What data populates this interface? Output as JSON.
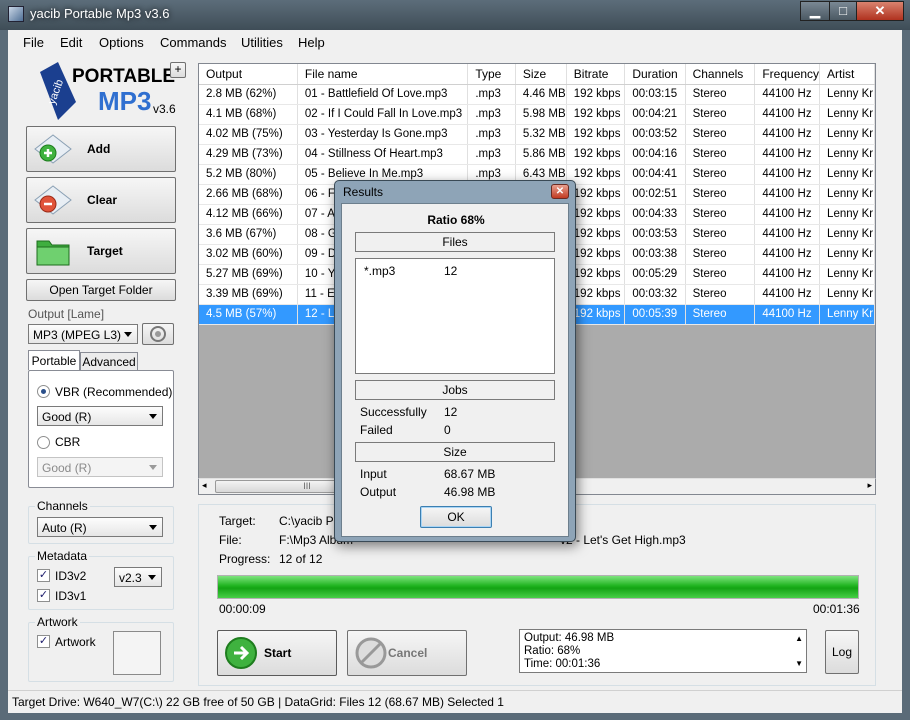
{
  "window": {
    "title": "yacib Portable Mp3 v3.6",
    "min": "▁",
    "max": "□",
    "close": "✕"
  },
  "menu": [
    "File",
    "Edit",
    "Options",
    "Commands",
    "Utilities",
    "Help"
  ],
  "logo": {
    "line1": "PORTABLE",
    "line2": "MP3",
    "version": "v3.6",
    "brand": "yacib"
  },
  "plus_label": "+",
  "buttons": {
    "add": "Add",
    "clear": "Clear",
    "target": "Target",
    "open_target": "Open Target Folder",
    "start": "Start",
    "cancel": "Cancel",
    "log": "Log",
    "ok": "OK"
  },
  "output": {
    "label": "Output [Lame]",
    "value": "MP3 (MPEG L3)"
  },
  "tabs": [
    "Portable",
    "Advanced"
  ],
  "vbr": {
    "label": "VBR (Recommended)",
    "value": "Good (R)",
    "checked": true
  },
  "cbr": {
    "label": "CBR",
    "value": "Good (R)",
    "checked": false
  },
  "channels": {
    "label": "Channels",
    "value": "Auto (R)"
  },
  "metadata": {
    "label": "Metadata",
    "id3v2": "ID3v2",
    "id3v1": "ID3v1",
    "version": "v2.3"
  },
  "artwork": {
    "label": "Artwork",
    "check": "Artwork"
  },
  "grid": {
    "columns": [
      "Output",
      "File name",
      "Type",
      "Size",
      "Bitrate",
      "Duration",
      "Channels",
      "Frequency",
      "Artist"
    ],
    "rows": [
      [
        "2.8 MB (62%)",
        "01 - Battlefield Of Love.mp3",
        ".mp3",
        "4.46 MB",
        "192 kbps",
        "00:03:15",
        "Stereo",
        "44100 Hz",
        "Lenny Kr"
      ],
      [
        "4.1 MB (68%)",
        "02 - If I Could Fall In Love.mp3",
        ".mp3",
        "5.98 MB",
        "192 kbps",
        "00:04:21",
        "Stereo",
        "44100 Hz",
        "Lenny Kr"
      ],
      [
        "4.02 MB (75%)",
        "03 - Yesterday Is Gone.mp3",
        ".mp3",
        "5.32 MB",
        "192 kbps",
        "00:03:52",
        "Stereo",
        "44100 Hz",
        "Lenny Kr"
      ],
      [
        "4.29 MB (73%)",
        "04 - Stillness Of Heart.mp3",
        ".mp3",
        "5.86 MB",
        "192 kbps",
        "00:04:16",
        "Stereo",
        "44100 Hz",
        "Lenny Kr"
      ],
      [
        "5.2 MB (80%)",
        "05 - Believe In Me.mp3",
        ".mp3",
        "6.43 MB",
        "192 kbps",
        "00:04:41",
        "Stereo",
        "44100 Hz",
        "Lenny Kr"
      ],
      [
        "2.66 MB (68%)",
        "06 - F",
        "",
        "",
        "192 kbps",
        "00:02:51",
        "Stereo",
        "44100 Hz",
        "Lenny Kr"
      ],
      [
        "4.12 MB (66%)",
        "07 - A",
        "",
        "",
        "192 kbps",
        "00:04:33",
        "Stereo",
        "44100 Hz",
        "Lenny Kr"
      ],
      [
        "3.6 MB (67%)",
        "08 - G",
        "",
        "",
        "192 kbps",
        "00:03:53",
        "Stereo",
        "44100 Hz",
        "Lenny Kr"
      ],
      [
        "3.02 MB (60%)",
        "09 - D",
        "",
        "",
        "192 kbps",
        "00:03:38",
        "Stereo",
        "44100 Hz",
        "Lenny Kr"
      ],
      [
        "5.27 MB (69%)",
        "10 - Y",
        "",
        "",
        "192 kbps",
        "00:05:29",
        "Stereo",
        "44100 Hz",
        "Lenny Kr"
      ],
      [
        "3.39 MB (69%)",
        "11 - E",
        "",
        "",
        "192 kbps",
        "00:03:32",
        "Stereo",
        "44100 Hz",
        "Lenny Kr"
      ],
      [
        "4.5 MB (57%)",
        "12 - L",
        "",
        "",
        "192 kbps",
        "00:05:39",
        "Stereo",
        "44100 Hz",
        "Lenny Kr"
      ]
    ],
    "selected_row": 11
  },
  "scroll_thumb": "III",
  "status": {
    "target_label": "Target:",
    "target_value": "C:\\yacib Po",
    "file_label": "File:",
    "file_value": "F:\\Mp3 Album",
    "file_value_tail": "v2 - Let's Get High.mp3",
    "progress_label": "Progress:",
    "progress_value": "12 of 12",
    "progress": 1.0,
    "elapsed": "00:00:09",
    "total": "00:01:36"
  },
  "log": [
    "Output: 46.98 MB",
    "Ratio: 68%",
    "Time: 00:01:36"
  ],
  "statusbar": "Target Drive: W640_W7(C:\\) 22 GB free of 50 GB  |  DataGrid:  Files  12  (68.67 MB)  Selected  1",
  "dialog": {
    "title": "Results",
    "ratio": "Ratio 68%",
    "files_header": "Files",
    "files": [
      {
        "ext": "*.mp3",
        "count": "12"
      }
    ],
    "jobs_header": "Jobs",
    "success_label": "Successfully",
    "success_value": "12",
    "failed_label": "Failed",
    "failed_value": "0",
    "size_header": "Size",
    "input_label": "Input",
    "input_value": "68.67 MB",
    "output_label": "Output",
    "output_value": "46.98 MB"
  }
}
